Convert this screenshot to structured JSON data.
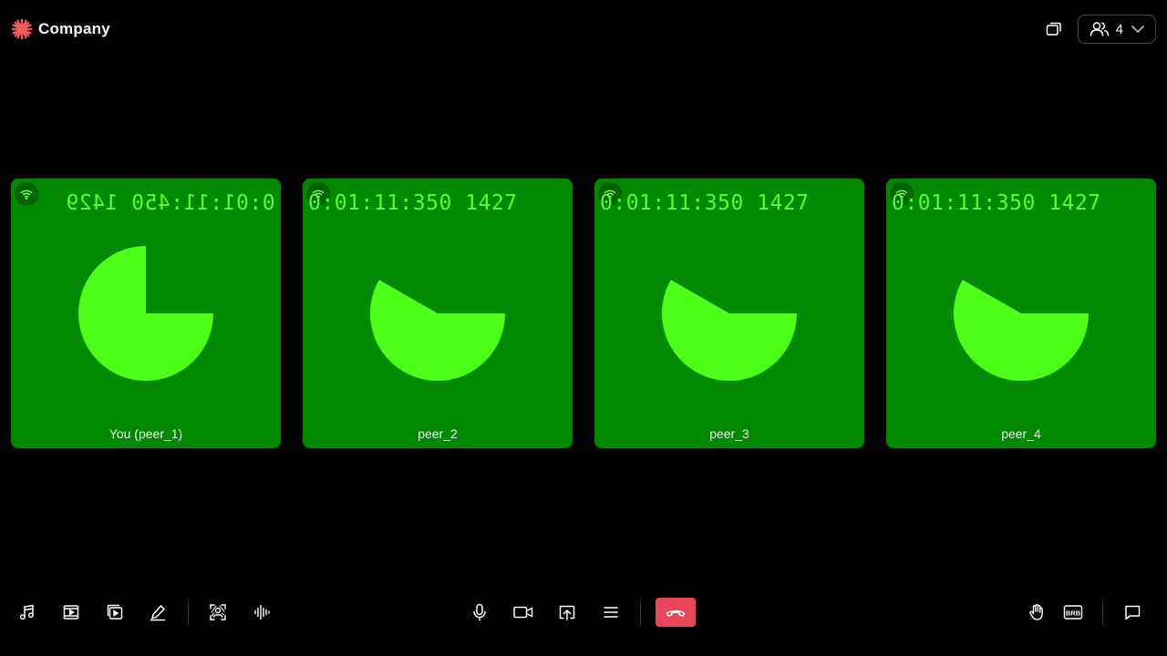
{
  "header": {
    "brand_name": "Company",
    "logo_icon": "sunburst-logo-icon",
    "logo_color": "#f05a5a",
    "layout_icon": "layout-switch-icon",
    "participants_icon": "people-icon",
    "participants_count": "4",
    "participants_dropdown_icon": "chevron-down-icon"
  },
  "tiles": [
    {
      "name": "You (peer_1)",
      "timer": "0:01:11:450 1429",
      "mirrored": true,
      "pie_fraction": 0.75,
      "network_icon": "wifi-icon"
    },
    {
      "name": "peer_2",
      "timer": "0:01:11:350 1427",
      "mirrored": false,
      "pie_fraction": 0.583,
      "network_icon": "wifi-icon"
    },
    {
      "name": "peer_3",
      "timer": "0:01:11:350 1427",
      "mirrored": false,
      "pie_fraction": 0.583,
      "network_icon": "wifi-icon"
    },
    {
      "name": "peer_4",
      "timer": "0:01:11:350 1427",
      "mirrored": false,
      "pie_fraction": 0.583,
      "network_icon": "wifi-icon"
    }
  ],
  "colors": {
    "tile_background": "#008800",
    "timer_text": "#55ff22",
    "pie_fill": "#4cff16",
    "leave_button": "#e8455a"
  },
  "controls": {
    "left": [
      "music-icon",
      "video-play-icon",
      "playlist-icon",
      "pencil-icon",
      "virtual-background-icon",
      "audio-waveform-icon"
    ],
    "center": [
      "microphone-icon",
      "camera-icon",
      "screen-share-icon",
      "menu-icon"
    ],
    "leave_icon": "hang-up-icon",
    "right": [
      "raise-hand-icon",
      "brb-icon",
      "chat-icon"
    ],
    "brb_label": "BRB"
  }
}
